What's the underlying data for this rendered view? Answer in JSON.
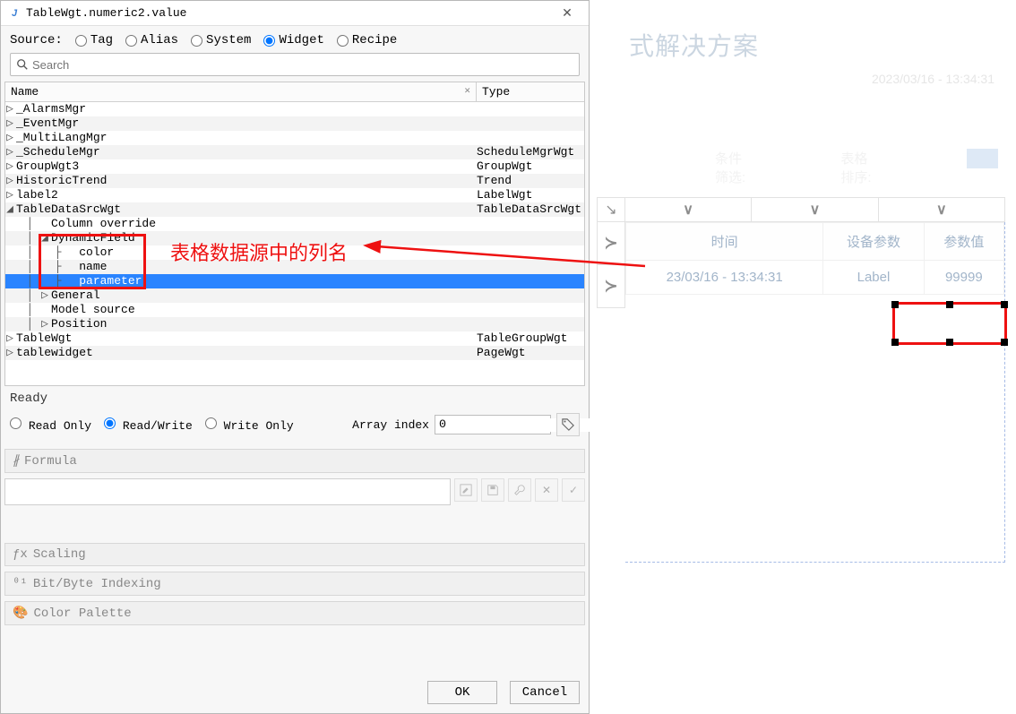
{
  "dialog": {
    "app_icon_letter": "J",
    "title": "TableWgt.numeric2.value",
    "source_label": "Source:",
    "source_options": {
      "tag": "Tag",
      "alias": "Alias",
      "system": "System",
      "widget": "Widget",
      "recipe": "Recipe"
    },
    "source_selected": "widget",
    "search_placeholder": "Search",
    "tree_headers": {
      "name": "Name",
      "type": "Type"
    },
    "tree": [
      {
        "lvl": 0,
        "exp": "▷",
        "name": "_AlarmsMgr",
        "type": ""
      },
      {
        "lvl": 0,
        "exp": "▷",
        "name": "_EventMgr",
        "type": ""
      },
      {
        "lvl": 0,
        "exp": "▷",
        "name": "_MultiLangMgr",
        "type": ""
      },
      {
        "lvl": 0,
        "exp": "▷",
        "name": "_ScheduleMgr",
        "type": "ScheduleMgrWgt"
      },
      {
        "lvl": 0,
        "exp": "▷",
        "name": "GroupWgt3",
        "type": "GroupWgt"
      },
      {
        "lvl": 0,
        "exp": "▷",
        "name": "HistoricTrend",
        "type": "Trend"
      },
      {
        "lvl": 0,
        "exp": "▷",
        "name": "label2",
        "type": "LabelWgt"
      },
      {
        "lvl": 0,
        "exp": "◢",
        "name": "TableDataSrcWgt",
        "type": "TableDataSrcWgt"
      },
      {
        "lvl": 1,
        "exp": "",
        "name": "Column override",
        "type": ""
      },
      {
        "lvl": 1,
        "exp": "◢",
        "name": "DynamicField",
        "type": ""
      },
      {
        "lvl": 2,
        "exp": "",
        "name": "color",
        "type": ""
      },
      {
        "lvl": 2,
        "exp": "",
        "name": "name",
        "type": ""
      },
      {
        "lvl": 2,
        "exp": "",
        "name": "parameter",
        "type": "",
        "sel": true
      },
      {
        "lvl": 1,
        "exp": "▷",
        "name": "General",
        "type": ""
      },
      {
        "lvl": 1,
        "exp": "",
        "name": "Model source",
        "type": ""
      },
      {
        "lvl": 1,
        "exp": "▷",
        "name": "Position",
        "type": ""
      },
      {
        "lvl": 0,
        "exp": "▷",
        "name": "TableWgt",
        "type": "TableGroupWgt"
      },
      {
        "lvl": 0,
        "exp": "▷",
        "name": "tablewidget",
        "type": "PageWgt"
      }
    ],
    "status": "Ready",
    "rw": {
      "read_only": "Read Only",
      "read_write": "Read/Write",
      "write_only": "Write Only",
      "selected": "read_write"
    },
    "array_index_label": "Array index",
    "array_index_value": "0",
    "sections": {
      "formula": "Formula",
      "scaling": "Scaling",
      "bitbyte": "Bit/Byte Indexing",
      "palette": "Color Palette"
    },
    "buttons": {
      "ok": "OK",
      "cancel": "Cancel"
    }
  },
  "page": {
    "header_text": "式解决方案",
    "datetime": "2023/03/16 - 13:34:31",
    "faint_label_a": "条件筛选:",
    "faint_label_b": "表格排序:",
    "corner_glyph": "↘",
    "tick_glyph": "∨",
    "gutter_glyph": "≻",
    "table": {
      "headers": [
        "时间",
        "设备参数",
        "参数值"
      ],
      "row": [
        "23/03/16 - 13:34:31",
        "Label",
        "99999"
      ]
    }
  },
  "annotations": {
    "callout_text": "表格数据源中的列名"
  }
}
